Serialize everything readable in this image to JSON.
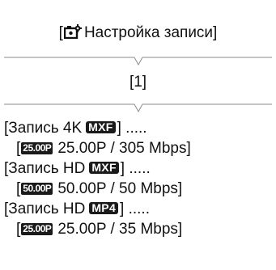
{
  "menu": {
    "bracket_open": "[",
    "title": "Настройка записи",
    "bracket_close": "]",
    "icon": "camera-settings-icon"
  },
  "submenu": {
    "label": "[1]"
  },
  "entries": [
    {
      "prefix": "[Запись 4K",
      "format_badge": "MXF",
      "suffix": "] .....",
      "value_open": "[",
      "rate_badge": "25.00P",
      "value": "25.00P / 305 Mbps]"
    },
    {
      "prefix": "[Запись HD",
      "format_badge": "MXF",
      "suffix": "] .....",
      "value_open": "[",
      "rate_badge": "50.00P",
      "value": "50.00P / 50 Mbps]"
    },
    {
      "prefix": "[Запись HD",
      "format_badge": "MP4",
      "suffix": "] .....",
      "value_open": "[",
      "rate_badge": "25.00P",
      "value": "25.00P / 35 Mbps]"
    }
  ],
  "colors": {
    "text": "#111111",
    "badge_bg": "#1a1a1a",
    "separator": "#8a8a8a"
  }
}
